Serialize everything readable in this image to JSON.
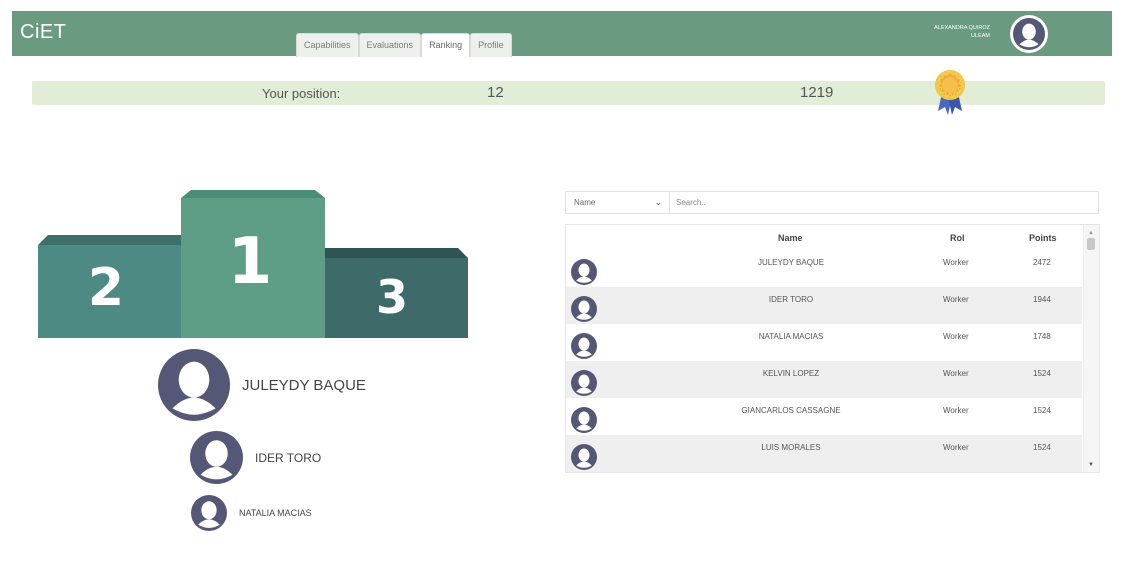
{
  "app": {
    "logo": "CiET"
  },
  "nav": {
    "tabs": [
      {
        "label": "Capabilities",
        "active": false
      },
      {
        "label": "Evaluations",
        "active": false
      },
      {
        "label": "Ranking",
        "active": true
      },
      {
        "label": "Profile",
        "active": false
      }
    ]
  },
  "user": {
    "name": "ALEXANDRA QUIROZ",
    "org": "ULEAM",
    "avatar_icon": "user-avatar-icon"
  },
  "position": {
    "label": "Your position:",
    "rank": "12",
    "points": "1219",
    "badge_icon": "medal-icon"
  },
  "podium": {
    "places": [
      {
        "number": "2",
        "color": "#4d8a84"
      },
      {
        "number": "1",
        "color": "#5e9e87"
      },
      {
        "number": "3",
        "color": "#3e6b69"
      }
    ]
  },
  "winners": [
    {
      "name": "JULEYDY BAQUE"
    },
    {
      "name": "IDER TORO"
    },
    {
      "name": "NATALIA MACIAS"
    }
  ],
  "search": {
    "filter_value": "Name",
    "placeholder": "Search.."
  },
  "table": {
    "columns": {
      "name": "Name",
      "rol": "Rol",
      "points": "Points"
    },
    "rows": [
      {
        "name": "JULEYDY BAQUE",
        "rol": "Worker",
        "points": "2472"
      },
      {
        "name": "IDER TORO",
        "rol": "Worker",
        "points": "1944"
      },
      {
        "name": "NATALIA MACIAS",
        "rol": "Worker",
        "points": "1748"
      },
      {
        "name": "KELVIN LOPEZ",
        "rol": "Worker",
        "points": "1524"
      },
      {
        "name": "GIANCARLOS CASSAGNE",
        "rol": "Worker",
        "points": "1524"
      },
      {
        "name": "LUIS MORALES",
        "rol": "Worker",
        "points": "1524"
      }
    ]
  },
  "colors": {
    "header": "#6a9a80",
    "position_bar": "#e1edd7",
    "avatar": "#545776"
  }
}
